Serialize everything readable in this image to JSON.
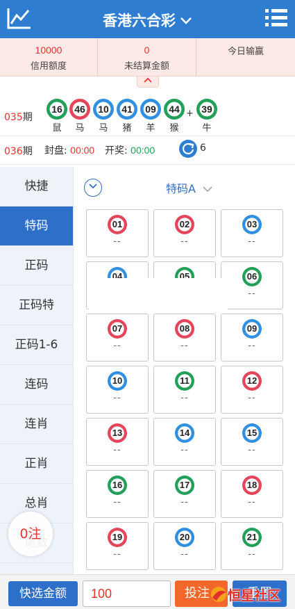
{
  "header": {
    "title": "香港六合彩",
    "chart_icon": "line-chart-icon",
    "menu_icon": "list-menu-icon"
  },
  "balance": {
    "credit_value": "10000",
    "credit_label": "信用额度",
    "pending_value": "0",
    "pending_label": "未结算金额",
    "today_label": "今日输赢"
  },
  "last_draw": {
    "period": "035",
    "period_suffix": "期",
    "balls": [
      {
        "num": "16",
        "zodiac": "鼠",
        "color": "green"
      },
      {
        "num": "46",
        "zodiac": "马",
        "color": "red"
      },
      {
        "num": "10",
        "zodiac": "马",
        "color": "blue"
      },
      {
        "num": "41",
        "zodiac": "猪",
        "color": "blue"
      },
      {
        "num": "09",
        "zodiac": "羊",
        "color": "blue"
      },
      {
        "num": "44",
        "zodiac": "猴",
        "color": "green"
      }
    ],
    "plus": "+",
    "special": {
      "num": "39",
      "zodiac": "牛",
      "color": "green"
    }
  },
  "current_draw": {
    "period": "036",
    "period_suffix": "期",
    "close_label": "封盘:",
    "close_time": "00:00",
    "open_label": "开奖:",
    "open_time": "00:00",
    "refresh_count": "6"
  },
  "sidebar": {
    "items": [
      {
        "label": "快捷"
      },
      {
        "label": "特码"
      },
      {
        "label": "正码"
      },
      {
        "label": "正码特"
      },
      {
        "label": "正码1-6"
      },
      {
        "label": "连码"
      },
      {
        "label": "连肖"
      },
      {
        "label": "正肖"
      },
      {
        "label": "总肖"
      },
      {
        "label": "尾数"
      }
    ],
    "active_index": 1
  },
  "main": {
    "type_select": "特码A",
    "cells": [
      {
        "num": "01",
        "color": "red",
        "odds": "--"
      },
      {
        "num": "02",
        "color": "red",
        "odds": "--"
      },
      {
        "num": "03",
        "color": "blue",
        "odds": "--"
      },
      {
        "num": "04",
        "color": "blue",
        "odds": "--"
      },
      {
        "num": "05",
        "color": "green",
        "odds": "--"
      },
      {
        "num": "06",
        "color": "green",
        "odds": "--"
      },
      {
        "num": "07",
        "color": "red",
        "odds": "--"
      },
      {
        "num": "08",
        "color": "red",
        "odds": "--"
      },
      {
        "num": "09",
        "color": "blue",
        "odds": "--"
      },
      {
        "num": "10",
        "color": "blue",
        "odds": "--"
      },
      {
        "num": "11",
        "color": "green",
        "odds": "--"
      },
      {
        "num": "12",
        "color": "red",
        "odds": "--"
      },
      {
        "num": "13",
        "color": "red",
        "odds": "--"
      },
      {
        "num": "14",
        "color": "blue",
        "odds": "--"
      },
      {
        "num": "15",
        "color": "blue",
        "odds": "--"
      },
      {
        "num": "16",
        "color": "green",
        "odds": "--"
      },
      {
        "num": "17",
        "color": "green",
        "odds": "--"
      },
      {
        "num": "18",
        "color": "red",
        "odds": "--"
      },
      {
        "num": "19",
        "color": "red",
        "odds": "--"
      },
      {
        "num": "20",
        "color": "blue",
        "odds": "--"
      },
      {
        "num": "21",
        "color": "green",
        "odds": "--"
      }
    ]
  },
  "float_counter": "0注",
  "bottom": {
    "quick_amount_label": "快选金额",
    "amount_value": "100",
    "bet_label": "投注",
    "reset_label": "重置"
  },
  "watermark_text": "恒星社区",
  "colors": {
    "primary": "#2e7dd1",
    "accent_red": "#e2352d",
    "ball_red": "#e5455b",
    "ball_blue": "#2f8fe0",
    "ball_green": "#22a05a",
    "bet_orange": "#f2672a"
  }
}
